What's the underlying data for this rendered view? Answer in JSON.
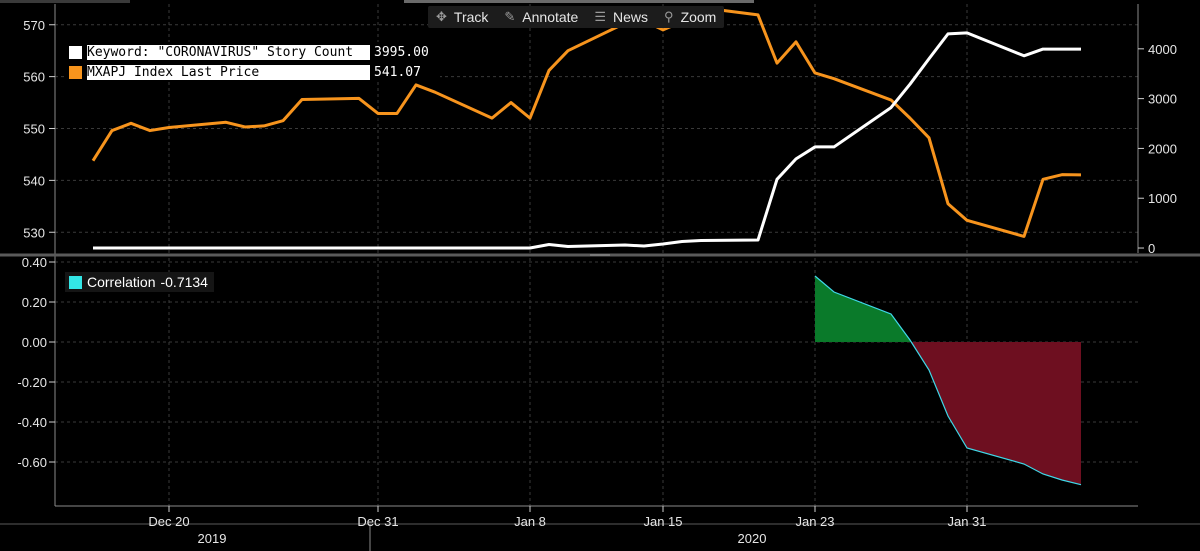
{
  "toolbar": {
    "items": [
      {
        "label": "Track",
        "icon": "crosshair-icon"
      },
      {
        "label": "Annotate",
        "icon": "pencil-icon"
      },
      {
        "label": "News",
        "icon": "news-icon"
      },
      {
        "label": "Zoom",
        "icon": "magnifier-icon"
      }
    ]
  },
  "colors": {
    "story_count": "#ffffff",
    "index_price": "#f7941d",
    "correlation_line": "#3fd8e8",
    "positive_fill": "#0a7a2a",
    "negative_fill": "#6e0f20",
    "grid": "#3a3a3a"
  },
  "top_legend": [
    {
      "label": "Keyword: \"CORONAVIRUS\" Story Count",
      "value": "3995.00",
      "color": "#ffffff"
    },
    {
      "label": "MXAPJ Index Last Price",
      "value": "541.07",
      "color": "#f7941d"
    }
  ],
  "bottom_legend": {
    "label": "Correlation",
    "value": "-0.7134",
    "color": "#33e6e6"
  },
  "chart_data": [
    {
      "type": "line",
      "x_ticks": [
        "Dec 20",
        "Dec 31",
        "Jan 8",
        "Jan 15",
        "Jan 23",
        "Jan 31"
      ],
      "year_labels": [
        "2019",
        "2020"
      ],
      "y_left_ticks": [
        "570",
        "560",
        "550",
        "540",
        "530"
      ],
      "y_right_ticks": [
        "4000",
        "3000",
        "2000",
        "1000",
        "0"
      ],
      "y_left_range": [
        526,
        574
      ],
      "y_right_range": [
        -100,
        4900
      ],
      "grid": true,
      "dates": [
        "2019-12-16",
        "2019-12-17",
        "2019-12-18",
        "2019-12-19",
        "2019-12-20",
        "2019-12-23",
        "2019-12-24",
        "2019-12-25",
        "2019-12-26",
        "2019-12-27",
        "2019-12-30",
        "2019-12-31",
        "2020-01-01",
        "2020-01-02",
        "2020-01-03",
        "2020-01-06",
        "2020-01-07",
        "2020-01-08",
        "2020-01-09",
        "2020-01-10",
        "2020-01-13",
        "2020-01-14",
        "2020-01-15",
        "2020-01-16",
        "2020-01-17",
        "2020-01-20",
        "2020-01-21",
        "2020-01-22",
        "2020-01-23",
        "2020-01-24",
        "2020-01-27",
        "2020-01-28",
        "2020-01-29",
        "2020-01-30",
        "2020-01-31",
        "2020-02-03",
        "2020-02-04",
        "2020-02-05",
        "2020-02-06"
      ],
      "series": [
        {
          "name": "MXAPJ Index Last Price",
          "axis": "left",
          "values": [
            543.8,
            549.6,
            551.0,
            549.6,
            550.2,
            551.2,
            550.3,
            550.5,
            551.5,
            555.6,
            555.8,
            552.9,
            552.9,
            558.4,
            557.0,
            552.0,
            555.0,
            552.0,
            561.2,
            565.0,
            570.3,
            570.8,
            569.0,
            570.6,
            573.3,
            571.9,
            562.6,
            566.7,
            560.7,
            559.6,
            555.5,
            552.0,
            548.2,
            535.5,
            532.3,
            529.2,
            540.2,
            541.1,
            541.07
          ]
        },
        {
          "name": "Keyword: \"CORONAVIRUS\" Story Count",
          "axis": "right",
          "values": [
            0,
            0,
            0,
            0,
            0,
            0,
            0,
            0,
            0,
            0,
            0,
            0,
            0,
            0,
            0,
            0,
            0,
            0,
            70,
            30,
            60,
            40,
            80,
            130,
            150,
            160,
            1380,
            1790,
            2030,
            2030,
            2820,
            3290,
            3800,
            4300,
            4320,
            3860,
            3995,
            3995,
            3995
          ]
        }
      ]
    },
    {
      "type": "area",
      "y_ticks": [
        "0.40",
        "0.20",
        "0.00",
        "-0.20",
        "-0.40",
        "-0.60"
      ],
      "y_range": [
        -0.82,
        0.42
      ],
      "grid": true,
      "dates": [
        "2020-01-23",
        "2020-01-24",
        "2020-01-27",
        "2020-01-28",
        "2020-01-29",
        "2020-01-30",
        "2020-01-31",
        "2020-02-03",
        "2020-02-04",
        "2020-02-05",
        "2020-02-06"
      ],
      "series": [
        {
          "name": "Correlation",
          "values": [
            0.33,
            0.25,
            0.14,
            0.01,
            -0.14,
            -0.37,
            -0.53,
            -0.61,
            -0.66,
            -0.69,
            -0.7134
          ]
        }
      ]
    }
  ]
}
